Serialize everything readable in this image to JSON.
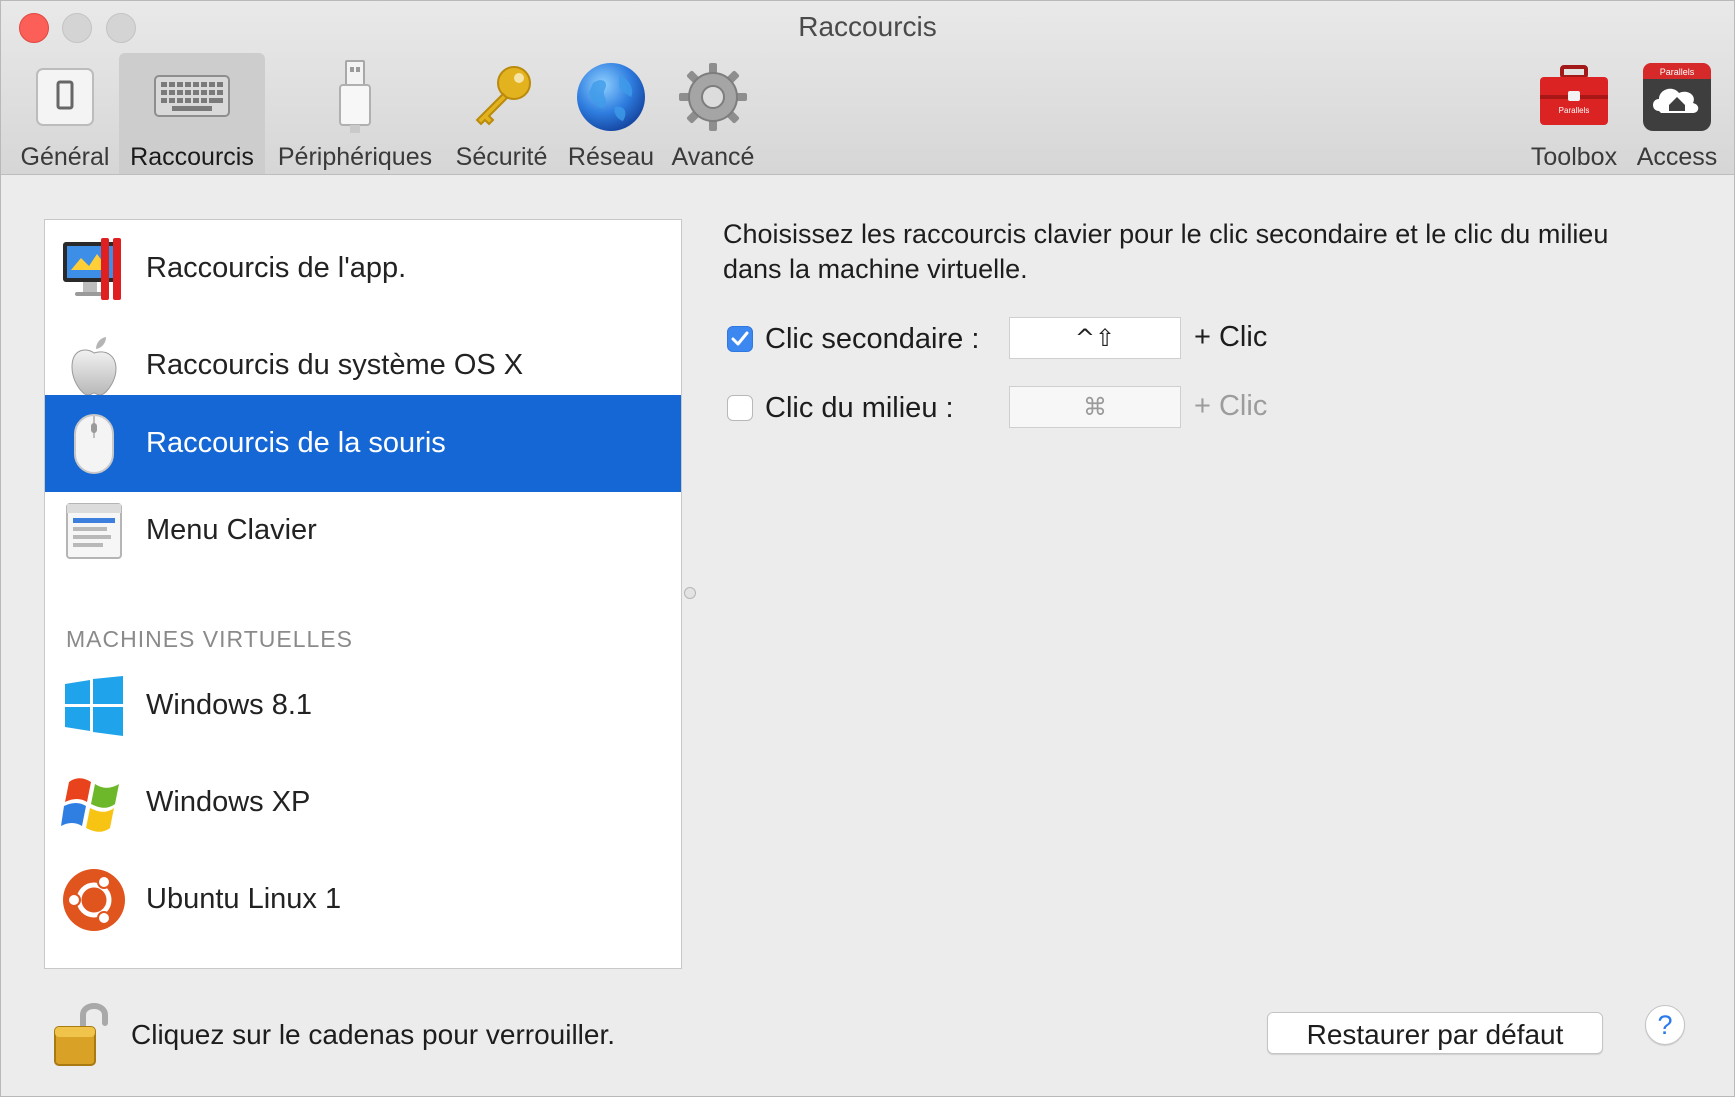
{
  "window": {
    "title": "Raccourcis"
  },
  "toolbar": {
    "tabs": [
      {
        "label": "Général",
        "icon": "general-icon",
        "active": false
      },
      {
        "label": "Raccourcis",
        "icon": "keyboard-icon",
        "active": true
      },
      {
        "label": "Périphériques",
        "icon": "usb-icon",
        "active": false
      },
      {
        "label": "Sécurité",
        "icon": "key-icon",
        "active": false
      },
      {
        "label": "Réseau",
        "icon": "globe-icon",
        "active": false
      },
      {
        "label": "Avancé",
        "icon": "gear-icon",
        "active": false
      }
    ],
    "right": [
      {
        "label": "Toolbox",
        "icon": "toolbox-icon",
        "icon_text": "Parallels"
      },
      {
        "label": "Access",
        "icon": "access-icon",
        "icon_text": "Parallels"
      }
    ]
  },
  "sidebar": {
    "items": [
      {
        "label": "Raccourcis de l'app.",
        "icon": "parallels-app-icon"
      },
      {
        "label": "Raccourcis du système OS X",
        "icon": "apple-icon"
      },
      {
        "label": "Raccourcis de la souris",
        "icon": "mouse-icon",
        "selected": true
      },
      {
        "label": "Menu Clavier",
        "icon": "keyboard-menu-icon"
      }
    ],
    "section_header": "MACHINES VIRTUELLES",
    "vms": [
      {
        "label": "Windows 8.1",
        "icon": "windows8-icon"
      },
      {
        "label": "Windows XP",
        "icon": "windowsxp-icon"
      },
      {
        "label": "Ubuntu Linux 1",
        "icon": "ubuntu-icon"
      }
    ]
  },
  "main": {
    "description": "Choisissez les raccourcis clavier pour le clic secondaire et le clic du milieu dans la machine virtuelle.",
    "options": [
      {
        "label": "Clic secondaire :",
        "checked": true,
        "shortcut": "^⇧",
        "suffix": "+ Clic"
      },
      {
        "label": "Clic du milieu :",
        "checked": false,
        "shortcut": "⌘",
        "suffix": "+ Clic"
      }
    ]
  },
  "footer": {
    "lock_text": "Cliquez sur le cadenas pour verrouiller.",
    "restore_label": "Restaurer par défaut",
    "help_label": "?"
  },
  "colors": {
    "selection": "#1667d6",
    "checkbox_checked": "#3c87f0",
    "close_button": "#fc5f57"
  }
}
